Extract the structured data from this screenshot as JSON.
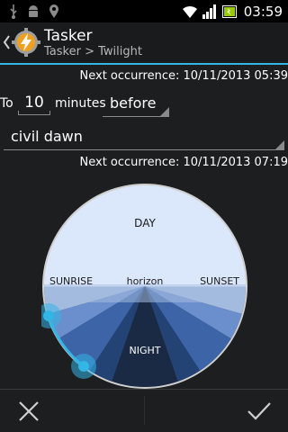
{
  "status_bar": {
    "time": "03:59",
    "icons": [
      "usb-icon",
      "android-debug-icon",
      "location-icon",
      "wifi-icon",
      "signal-icon",
      "battery-icon"
    ]
  },
  "action_bar": {
    "title": "Tasker",
    "subtitle": "Tasker > Twilight",
    "accent_color": "#33b5e5"
  },
  "next_occurrence_1": "Next occurrence: 10/11/2013 05:39",
  "offset_row": {
    "to_label": "To",
    "minutes_value": "10",
    "minutes_label": "minutes",
    "direction_value": "before"
  },
  "twilight_type": "civil dawn",
  "next_occurrence_2": "Next occurrence: 10/11/2013 07:19",
  "dial": {
    "day_label": "DAY",
    "sunrise_label": "SUNRISE",
    "horizon_label": "horizon",
    "sunset_label": "SUNSET",
    "night_label": "NIGHT",
    "colors": {
      "day": "#dbe7fb",
      "band1": "#a4bbe0",
      "band2": "#6b8fcc",
      "band3": "#3c64a7",
      "band4": "#244375",
      "night": "#1a2a44",
      "rim": "#cfcfcf",
      "handle": "#33b5e5"
    }
  },
  "bottom_bar": {
    "cancel": "close-icon",
    "confirm": "checkmark-icon"
  }
}
